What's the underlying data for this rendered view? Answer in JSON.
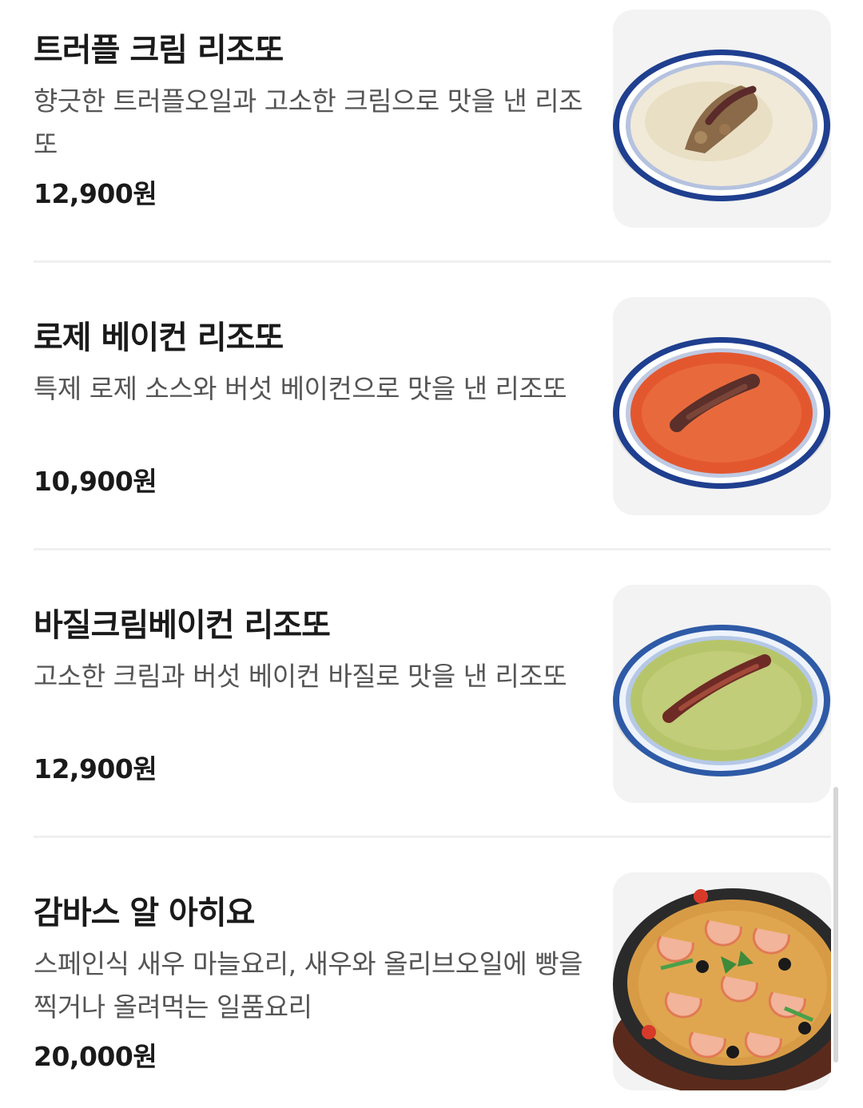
{
  "menu": {
    "items": [
      {
        "name": "트러플 크림 리조또",
        "description": "향긋한 트러플오일과 고소한 크림으로 맛을 낸 리조또",
        "price": "12,900원",
        "image_icon": "truffle-cream-risotto-photo"
      },
      {
        "name": "로제 베이컨 리조또",
        "description": "특제 로제 소스와 버섯 베이컨으로 맛을 낸 리조또",
        "price": "10,900원",
        "image_icon": "rose-bacon-risotto-photo"
      },
      {
        "name": "바질크림베이컨 리조또",
        "description": "고소한 크림과 버섯 베이컨 바질로 맛을 낸 리조또",
        "price": "12,900원",
        "image_icon": "basil-cream-bacon-risotto-photo"
      },
      {
        "name": "감바스 알 아히요",
        "description": "스페인식 새우 마늘요리, 새우와 올리브오일에 빵을 찍거나 올려먹는 일품요리",
        "price": "20,000원",
        "image_icon": "gambas-al-ajillo-photo"
      }
    ]
  },
  "colors": {
    "background": "#ffffff",
    "title": "#1a1a1a",
    "description": "#555555",
    "divider": "#f0f0f0",
    "thumb_bg": "#f3f3f3"
  }
}
